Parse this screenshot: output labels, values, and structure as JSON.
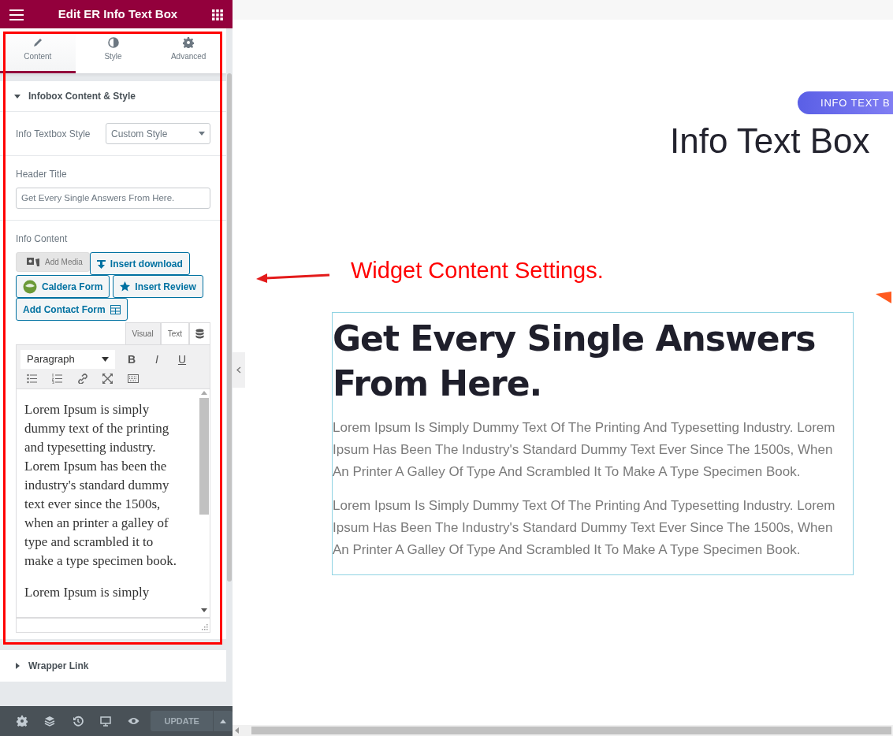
{
  "panel": {
    "title": "Edit ER Info Text Box"
  },
  "tabs": [
    {
      "label": "Content",
      "kind": "pencil",
      "selected": true
    },
    {
      "label": "Style",
      "kind": "contrast",
      "selected": false
    },
    {
      "label": "Advanced",
      "kind": "gear",
      "selected": false
    }
  ],
  "content_section": {
    "title": "Infobox Content & Style",
    "expanded": true,
    "style_field": {
      "label": "Info Textbox Style",
      "value": "Custom Style"
    },
    "header_field": {
      "label": "Header Title",
      "value": "Get Every Single Answers From Here."
    },
    "info_content": {
      "label": "Info Content",
      "media_buttons": [
        {
          "label": "Add Media",
          "kind": "media"
        },
        {
          "label": "Insert download",
          "kind": "download"
        },
        {
          "label": "Caldera Form",
          "kind": "caldera"
        },
        {
          "label": "Insert Review",
          "kind": "review"
        },
        {
          "label": "Add Contact Form",
          "kind": "contact"
        }
      ],
      "editor_tabs": [
        {
          "label": "Visual",
          "selected": true
        },
        {
          "label": "Text",
          "selected": false
        }
      ],
      "format_select": "Paragraph",
      "format_buttons": [
        {
          "label": "B",
          "kind": "bold"
        },
        {
          "label": "I",
          "kind": "italic"
        },
        {
          "label": "U",
          "kind": "underline"
        }
      ],
      "tool_buttons": [
        {
          "kind": "bullets"
        },
        {
          "kind": "numbers"
        },
        {
          "kind": "link"
        },
        {
          "kind": "fullscreen"
        },
        {
          "kind": "keyboard"
        }
      ],
      "paragraphs": [
        "Lorem Ipsum is simply dummy text of the printing and typesetting industry. Lorem Ipsum has been the industry's standard dummy text ever since the 1500s, when an printer a galley of type and scrambled it to make a type specimen book.",
        "Lorem Ipsum is simply"
      ]
    }
  },
  "wrapper_section": {
    "title": "Wrapper Link",
    "expanded": false
  },
  "footer": {
    "tools": [
      {
        "kind": "gear"
      },
      {
        "kind": "layers"
      },
      {
        "kind": "history"
      },
      {
        "kind": "monitor"
      },
      {
        "kind": "eye"
      }
    ],
    "update_button": {
      "label": "UPDATE",
      "disabled": true
    }
  },
  "preview": {
    "badge": "INFO TEXT B",
    "heading": "Info Text Box",
    "box_title": "Get Every Single Answers From Here.",
    "box_paragraphs": [
      "Lorem Ipsum Is Simply Dummy Text Of The Printing And Typesetting Industry. Lorem Ipsum Has Been The Industry's Standard Dummy Text Ever Since The 1500s, When An Printer A Galley Of Type And Scrambled It To Make A Type Specimen Book.",
      "Lorem Ipsum Is Simply Dummy Text Of The Printing And Typesetting Industry. Lorem Ipsum Has Been The Industry's Standard Dummy Text Ever Since The 1500s, When An Printer A Galley Of Type And Scrambled It To Make A Type Specimen Book."
    ]
  },
  "annotation": {
    "text": "Widget Content Settings."
  }
}
